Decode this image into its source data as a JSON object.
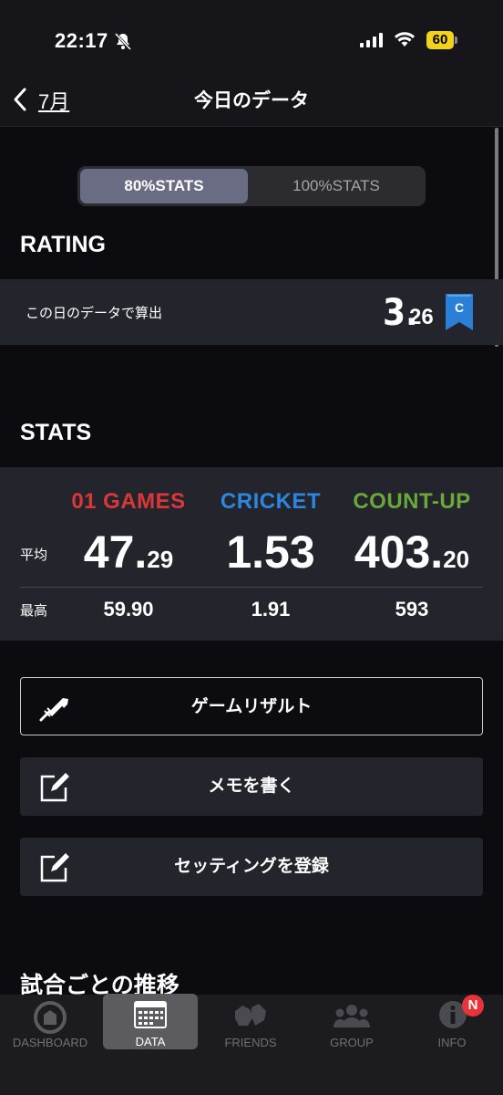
{
  "status": {
    "time": "22:17",
    "battery": "60"
  },
  "nav": {
    "back_label": "7月",
    "title": "今日のデータ"
  },
  "segment": {
    "options": [
      "80%STATS",
      "100%STATS"
    ]
  },
  "rating": {
    "heading": "RATING",
    "row_label": "この日のデータで算出",
    "value_int": "3.",
    "value_dec": "26",
    "class_flag": "C",
    "flag_color": "#2a7fd6"
  },
  "stats": {
    "heading": "STATS",
    "columns": [
      {
        "title": "01 GAMES",
        "color": "#d93838",
        "avg_int": "47.",
        "avg_dec": "29",
        "max": "59.90"
      },
      {
        "title": "CRICKET",
        "color": "#2b86e0",
        "avg_int": "1.53",
        "avg_dec": "",
        "max": "1.91"
      },
      {
        "title": "COUNT-UP",
        "color": "#6aa83a",
        "avg_int": "403.",
        "avg_dec": "20",
        "max": "593"
      }
    ],
    "avg_label": "平均",
    "max_label": "最高"
  },
  "buttons": {
    "game_result": "ゲームリザルト",
    "write_memo": "メモを書く",
    "register_setting": "セッティングを登録"
  },
  "trend_heading": "試合ごとの推移",
  "tabs": [
    {
      "label": "DASHBOARD",
      "icon": "dashboard-icon"
    },
    {
      "label": "DATA",
      "icon": "data-icon"
    },
    {
      "label": "FRIENDS",
      "icon": "friends-icon"
    },
    {
      "label": "GROUP",
      "icon": "group-icon"
    },
    {
      "label": "INFO",
      "icon": "info-icon"
    }
  ],
  "info_badge": "N"
}
